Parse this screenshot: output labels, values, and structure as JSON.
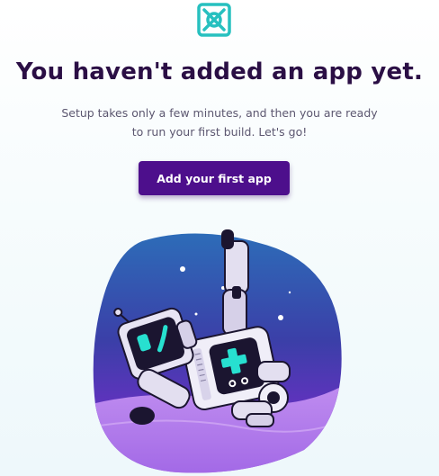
{
  "logo": {
    "icon": "bitrise-logo-icon",
    "color": "#27c0bf"
  },
  "empty_state": {
    "title": "You haven't added an app yet.",
    "subtitle_line1": "Setup takes only a few minutes, and then you are ready",
    "subtitle_line2": "to run your first build. Let's go!",
    "cta_label": "Add your first app"
  },
  "illustration": {
    "icon": "robot-illustration"
  },
  "colors": {
    "title": "#2b0f45",
    "button": "#4d0f8c",
    "accent": "#27c0bf",
    "illustration_top": "#2c64b4",
    "illustration_bottom": "#9d4de0"
  }
}
